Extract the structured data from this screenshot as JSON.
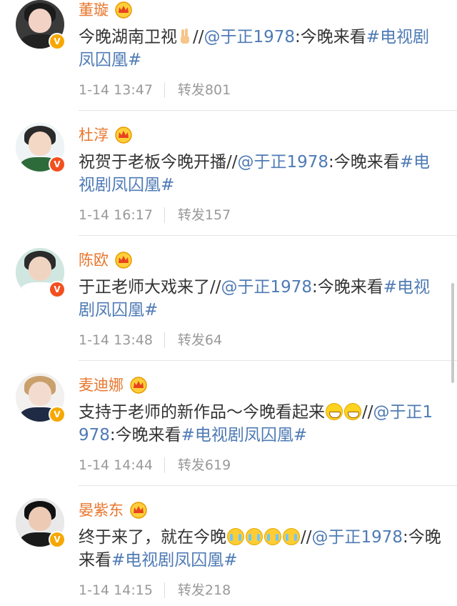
{
  "posts": [
    {
      "name": "董璇",
      "parts": [
        {
          "t": "今晚湖南卫视"
        },
        {
          "emoji": "victory-hand"
        },
        {
          "t": "//"
        },
        {
          "link": "@于正1978"
        },
        {
          "t": ":今晚来看"
        },
        {
          "link": "#电视剧凤囚凰#"
        }
      ],
      "time": "1-14 13:47",
      "repost": "转发801",
      "avatar": {
        "bg": "#3a3a3a",
        "skin": "#f2d2c4",
        "hair": "#1b1b1b",
        "body": "#222222"
      },
      "badge_color": "#f7a800"
    },
    {
      "name": "杜淳",
      "parts": [
        {
          "t": "祝贺于老板今晚开播//"
        },
        {
          "link": "@于正1978"
        },
        {
          "t": ":今晚来看"
        },
        {
          "link": "#电视剧凤囚凰#"
        }
      ],
      "time": "1-14 16:17",
      "repost": "转发157",
      "avatar": {
        "bg": "#eef3f6",
        "skin": "#f4d8c6",
        "hair": "#2a2a2a",
        "body": "#2e6b3a"
      },
      "badge_color": "#f24f1f"
    },
    {
      "name": "陈欧",
      "parts": [
        {
          "t": "于正老师大戏来了//"
        },
        {
          "link": "@于正1978"
        },
        {
          "t": ":今晚来看"
        },
        {
          "link": "#电视剧凤囚凰#"
        }
      ],
      "time": "1-14 13:48",
      "repost": "转发64",
      "avatar": {
        "bg": "#cfe7e0",
        "skin": "#f0d4c2",
        "hair": "#2b2b2b",
        "body": "#ffffff"
      },
      "badge_color": "#f24f1f"
    },
    {
      "name": "麦迪娜",
      "parts": [
        {
          "t": "支持于老师的新作品～今晚看起来"
        },
        {
          "emoji": "grin"
        },
        {
          "emoji": "grin"
        },
        {
          "t": "//"
        },
        {
          "link": "@于正1978"
        },
        {
          "t": ":今晚来看"
        },
        {
          "link": "#电视剧凤囚凰#"
        }
      ],
      "time": "1-14 14:44",
      "repost": "转发619",
      "avatar": {
        "bg": "#f3f1ef",
        "skin": "#f3dccf",
        "hair": "#c9a06c",
        "body": "#1f2a44"
      },
      "badge_color": "#f7a800"
    },
    {
      "name": "晏紫东",
      "parts": [
        {
          "t": "终于来了，就在今晚"
        },
        {
          "emoji": "cry"
        },
        {
          "emoji": "cry"
        },
        {
          "emoji": "cry"
        },
        {
          "emoji": "cry"
        },
        {
          "t": "//"
        },
        {
          "link": "@于正1978"
        },
        {
          "t": ":今晚来看"
        },
        {
          "link": "#电视剧凤囚凰#"
        }
      ],
      "time": "1-14 14:15",
      "repost": "转发218",
      "avatar": {
        "bg": "#e9e9e9",
        "skin": "#eccab4",
        "hair": "#111111",
        "body": "#1a1a1a"
      },
      "badge_color": "#f7a800"
    }
  ],
  "colors": {
    "name": "#e8762c",
    "link": "#4f7bb5",
    "text": "#333333",
    "meta": "#999999"
  }
}
